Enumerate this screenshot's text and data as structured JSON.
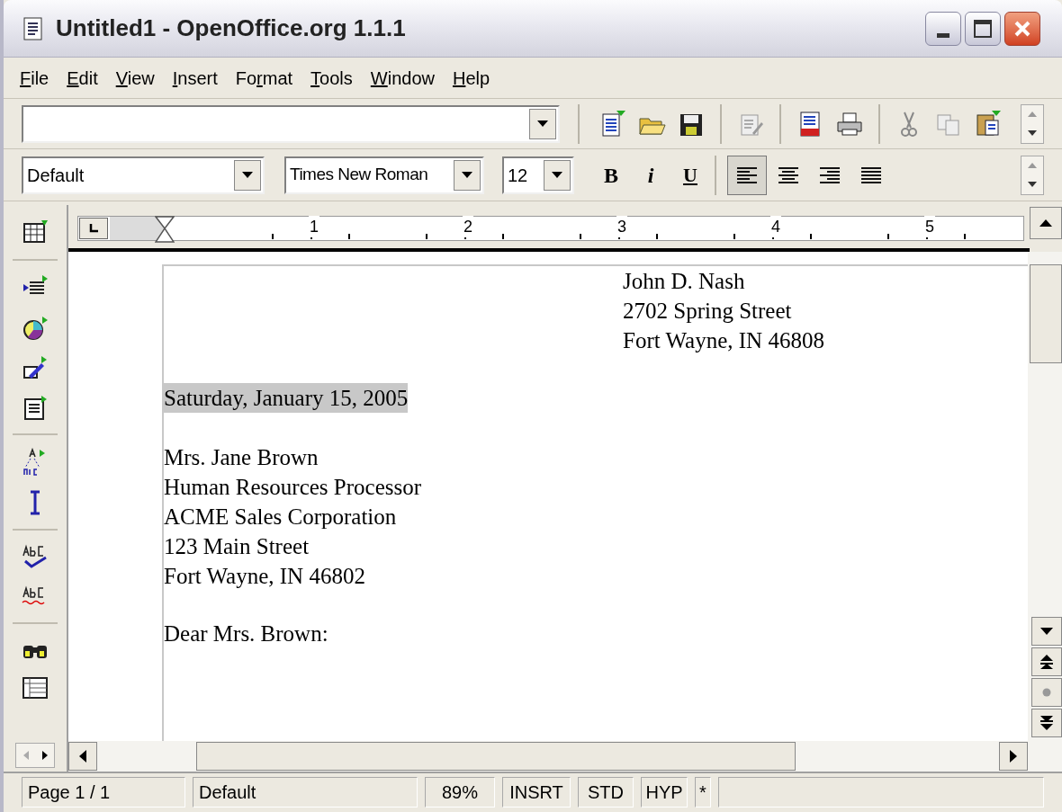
{
  "window": {
    "title": "Untitled1 - OpenOffice.org 1.1.1"
  },
  "menu": [
    {
      "key": "F",
      "after": "ile"
    },
    {
      "key": "E",
      "after": "dit"
    },
    {
      "key": "V",
      "after": "iew"
    },
    {
      "key": "I",
      "after": "nsert"
    },
    {
      "before": "Fo",
      "key": "r",
      "after": "mat"
    },
    {
      "key": "T",
      "after": "ools"
    },
    {
      "key": "W",
      "after": "indow"
    },
    {
      "key": "H",
      "after": "elp"
    }
  ],
  "object_bar": {
    "paragraph_style": "Default",
    "font_name": "Times New Roman",
    "font_size": "12",
    "bold": "B",
    "italic": "i",
    "underline": "U",
    "alignment": [
      {
        "kind": "left",
        "selected": true
      },
      {
        "kind": "center",
        "selected": false
      },
      {
        "kind": "right",
        "selected": false
      },
      {
        "kind": "justify",
        "selected": false
      }
    ]
  },
  "ruler": {
    "marks": [
      "1",
      "2",
      "3",
      "4",
      "5"
    ]
  },
  "document": {
    "sender": [
      "John D. Nash",
      "2702 Spring Street",
      "Fort Wayne, IN 46808"
    ],
    "date": {
      "text": "Saturday, January 15, 2005",
      "field_shading": true
    },
    "recipient": [
      "Mrs. Jane Brown",
      "Human Resources Processor",
      "ACME Sales Corporation",
      "123 Main Street",
      "Fort Wayne, IN 46802"
    ],
    "salutation": "Dear Mrs. Brown:"
  },
  "status_bar": [
    "Page 1 / 1",
    "Default",
    "89%",
    "INSRT",
    "STD",
    "HYP",
    "*"
  ]
}
